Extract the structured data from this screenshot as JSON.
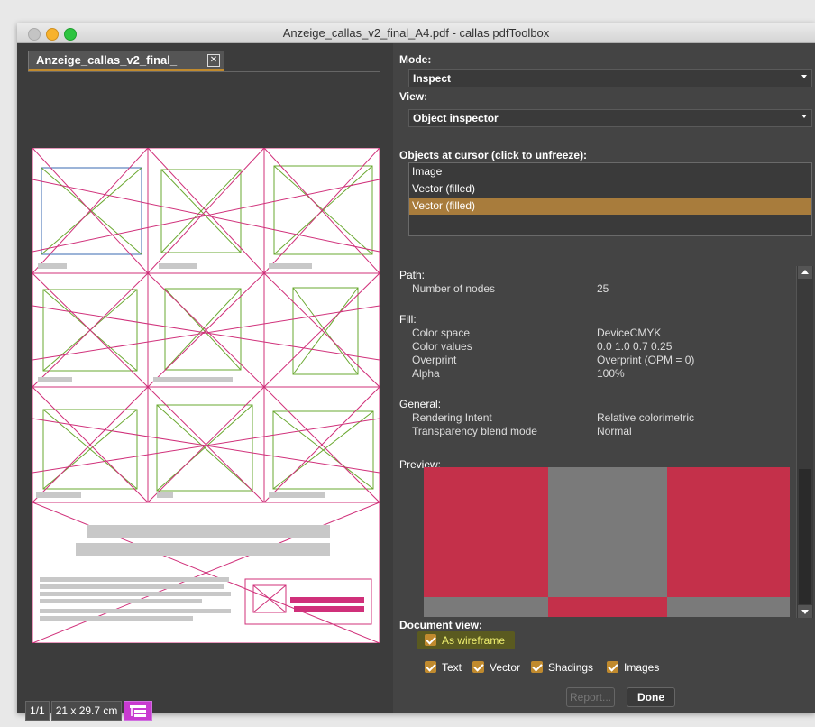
{
  "window": {
    "title": "Anzeige_callas_v2_final_A4.pdf - callas pdfToolbox"
  },
  "document_tab": {
    "label": "Anzeige_callas_v2_final_",
    "close": "✕"
  },
  "status": {
    "page": "1/1",
    "size": "21 x 29.7 cm"
  },
  "mode": {
    "label": "Mode:",
    "value": "Inspect"
  },
  "view": {
    "label": "View:",
    "value": "Object inspector"
  },
  "objects": {
    "label": "Objects at cursor (click to unfreeze):",
    "items": [
      "Image",
      "Vector (filled)",
      "Vector (filled)"
    ],
    "selected_index": 2
  },
  "path": {
    "label": "Path:",
    "nodes_label": "Number of nodes",
    "nodes_value": "25"
  },
  "fill": {
    "label": "Fill:",
    "color_space_label": "Color space",
    "color_space_value": "DeviceCMYK",
    "color_values_label": "Color values",
    "color_values_value": "0.0  1.0  0.7  0.25",
    "overprint_label": "Overprint",
    "overprint_value": "Overprint (OPM = 0)",
    "alpha_label": "Alpha",
    "alpha_value": "100%"
  },
  "general": {
    "label": "General:",
    "rendering_label": "Rendering Intent",
    "rendering_value": "Relative colorimetric",
    "blend_label": "Transparency blend mode",
    "blend_value": "Normal"
  },
  "preview": {
    "label": "Preview:",
    "color_red": "#c4304a",
    "color_gray": "#7a7a7a"
  },
  "document_view": {
    "label": "Document view:",
    "as_wireframe": "As wireframe",
    "text": "Text",
    "vector": "Vector",
    "shadings": "Shadings",
    "images": "Images"
  },
  "buttons": {
    "report": "Report...",
    "done": "Done"
  },
  "colors": {
    "accent": "#c08a2e",
    "wire_magenta": "#d0307a",
    "wire_green": "#6aa830",
    "selected_row": "#a87c3c"
  }
}
